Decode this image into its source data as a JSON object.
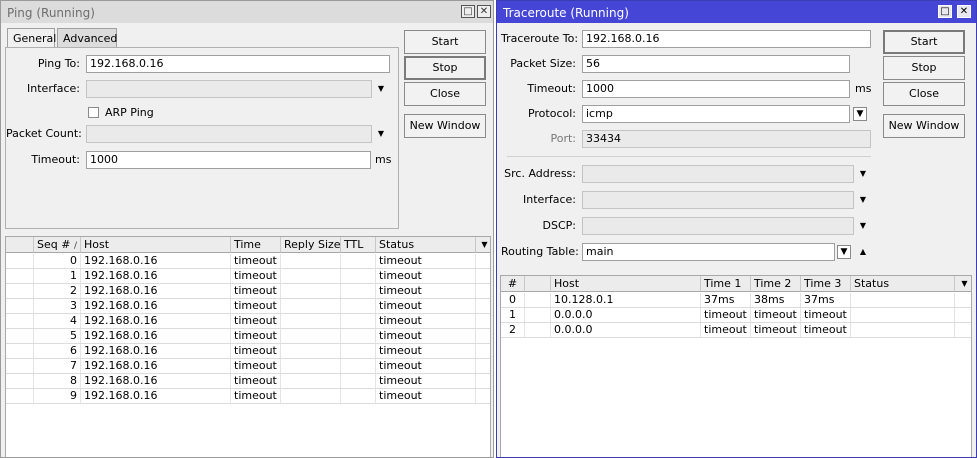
{
  "ping": {
    "title": "Ping (Running)",
    "tabs": [
      "General",
      "Advanced"
    ],
    "fields": {
      "ping_to_label": "Ping To:",
      "ping_to_value": "192.168.0.16",
      "interface_label": "Interface:",
      "interface_value": "",
      "arp_ping_label": "ARP Ping",
      "arp_ping_checked": false,
      "packet_count_label": "Packet Count:",
      "packet_count_value": "",
      "timeout_label": "Timeout:",
      "timeout_value": "1000",
      "timeout_unit": "ms"
    },
    "buttons": [
      "Start",
      "Stop",
      "Close",
      "New Window"
    ],
    "table": {
      "columns": [
        "",
        "Seq #",
        "Host",
        "Time",
        "Reply Size",
        "TTL",
        "Status"
      ],
      "sort_indicator": "/",
      "rows": [
        {
          "seq": "0",
          "host": "192.168.0.16",
          "time": "timeout",
          "reply_size": "",
          "ttl": "",
          "status": "timeout"
        },
        {
          "seq": "1",
          "host": "192.168.0.16",
          "time": "timeout",
          "reply_size": "",
          "ttl": "",
          "status": "timeout"
        },
        {
          "seq": "2",
          "host": "192.168.0.16",
          "time": "timeout",
          "reply_size": "",
          "ttl": "",
          "status": "timeout"
        },
        {
          "seq": "3",
          "host": "192.168.0.16",
          "time": "timeout",
          "reply_size": "",
          "ttl": "",
          "status": "timeout"
        },
        {
          "seq": "4",
          "host": "192.168.0.16",
          "time": "timeout",
          "reply_size": "",
          "ttl": "",
          "status": "timeout"
        },
        {
          "seq": "5",
          "host": "192.168.0.16",
          "time": "timeout",
          "reply_size": "",
          "ttl": "",
          "status": "timeout"
        },
        {
          "seq": "6",
          "host": "192.168.0.16",
          "time": "timeout",
          "reply_size": "",
          "ttl": "",
          "status": "timeout"
        },
        {
          "seq": "7",
          "host": "192.168.0.16",
          "time": "timeout",
          "reply_size": "",
          "ttl": "",
          "status": "timeout"
        },
        {
          "seq": "8",
          "host": "192.168.0.16",
          "time": "timeout",
          "reply_size": "",
          "ttl": "",
          "status": "timeout"
        },
        {
          "seq": "9",
          "host": "192.168.0.16",
          "time": "timeout",
          "reply_size": "",
          "ttl": "",
          "status": "timeout"
        }
      ]
    }
  },
  "traceroute": {
    "title": "Traceroute (Running)",
    "fields": {
      "traceroute_to_label": "Traceroute To:",
      "traceroute_to_value": "192.168.0.16",
      "packet_size_label": "Packet Size:",
      "packet_size_value": "56",
      "timeout_label": "Timeout:",
      "timeout_value": "1000",
      "timeout_unit": "ms",
      "protocol_label": "Protocol:",
      "protocol_value": "icmp",
      "port_label": "Port:",
      "port_value": "33434",
      "src_address_label": "Src. Address:",
      "src_address_value": "",
      "interface_label": "Interface:",
      "interface_value": "",
      "dscp_label": "DSCP:",
      "dscp_value": "",
      "routing_table_label": "Routing Table:",
      "routing_table_value": "main"
    },
    "buttons": [
      "Start",
      "Stop",
      "Close",
      "New Window"
    ],
    "table": {
      "columns": [
        "#",
        "",
        "Host",
        "Time 1",
        "Time 2",
        "Time 3",
        "Status"
      ],
      "rows": [
        {
          "num": "0",
          "host": "10.128.0.1",
          "t1": "37ms",
          "t2": "38ms",
          "t3": "37ms",
          "status": ""
        },
        {
          "num": "1",
          "host": "0.0.0.0",
          "t1": "timeout",
          "t2": "timeout",
          "t3": "timeout",
          "status": ""
        },
        {
          "num": "2",
          "host": "0.0.0.0",
          "t1": "timeout",
          "t2": "timeout",
          "t3": "timeout",
          "status": ""
        }
      ]
    }
  },
  "icons": {
    "maximize": "maximize-icon",
    "close": "close-icon",
    "dropdown": "dropdown-arrow-icon",
    "column_menu": "column-menu-icon",
    "select_down": "select-down-icon",
    "collapse": "collapse-up-icon"
  },
  "colors": {
    "active_titlebar": "#4646d6",
    "inactive_titlebar": "#dcdcdc",
    "window_bg": "#f0f0f0"
  }
}
